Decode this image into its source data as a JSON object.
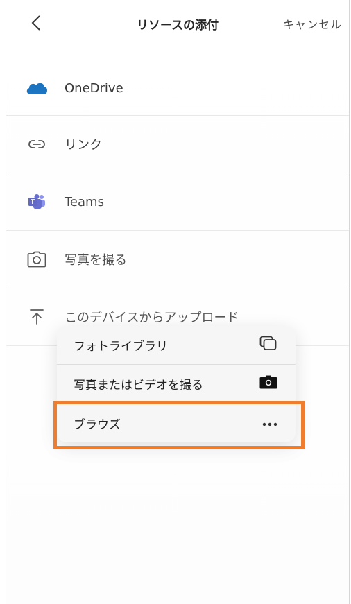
{
  "header": {
    "title": "リソースの添付",
    "cancel_label": "キャンセル"
  },
  "attach_options": [
    {
      "label": "OneDrive",
      "icon": "onedrive-icon"
    },
    {
      "label": "リンク",
      "icon": "link-icon"
    },
    {
      "label": "Teams",
      "icon": "teams-icon"
    },
    {
      "label": "写真を撮る",
      "icon": "camera-icon"
    },
    {
      "label": "このデバイスからアップロード",
      "icon": "upload-icon"
    }
  ],
  "upload_menu": [
    {
      "label": "フォトライブラリ",
      "icon": "photo-library-icon"
    },
    {
      "label": "写真またはビデオを撮る",
      "icon": "camera-filled-icon"
    },
    {
      "label": "ブラウズ",
      "icon": "more-icon"
    }
  ],
  "colors": {
    "highlight": "#ee7d2d",
    "onedrive": "#0f6cbd",
    "teams": "#5059c9"
  }
}
